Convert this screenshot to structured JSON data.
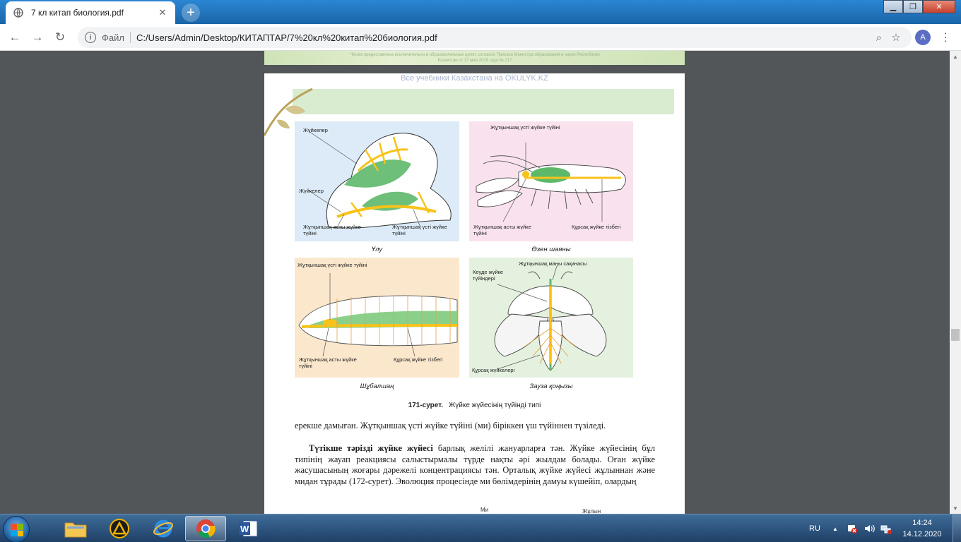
{
  "browser": {
    "tab_title": "7 кл китап биология.pdf",
    "new_tab_label": "+",
    "address_scheme": "Файл",
    "address_url": "C:/Users/Admin/Desktop/КИТАПТАР/7%20кл%20китап%20биология.pdf",
    "avatar_letter": "A"
  },
  "pdf": {
    "prev_page_fine_print": "*Книга предоставлена исключительно в образовательных целях согласно Приказа Министра образования и науки Республики Казахстан от 17 мая 2019 года № 217",
    "watermark": "Все учебники Казахстана на OKULYK.KZ",
    "figure": {
      "snail": {
        "labels": [
          "Жүйкелер",
          "Жүйкелер",
          "Жұтқыншақ асты жүйке түйіні",
          "Жұтқыншақ үсті жүйке түйіні"
        ],
        "caption": "Ұлу"
      },
      "crayfish": {
        "labels": [
          "Жұтқыншақ үсті жүйке түйіні",
          "Жұтқыншақ асты жүйке түйіні",
          "Құрсақ жүйке тізбегі"
        ],
        "caption": "Өзен шаяны"
      },
      "worm": {
        "labels": [
          "Жұтқыншақ үсті жүйке түйіні",
          "Жұтқыншақ асты жүйке түйіні",
          "Құрсақ жүйке тізбегі"
        ],
        "caption": "Шұбалшаң"
      },
      "beetle": {
        "labels": [
          "Жұтқыншақ маңы сақинасы",
          "Кеуде жүйке түйіндері",
          "Құрсақ жүйкелері"
        ],
        "caption": "Зауза қоңызы"
      },
      "number": "171-сурет.",
      "title": "Жүйке жүйесінің түйінді типі"
    },
    "paragraph1": "ерекше дамыған. Жұтқыншақ үсті жүйке түйіні (ми) біріккен үш түйіннен түзіледі.",
    "paragraph2_term": "Түтікше тәрізді жүйке жүйесі",
    "paragraph2_rest": " барлық желілі жануарларға тән. Жүйке жүйесінің бұл типінің жауап реакциясы салыстырмалы түрде нақты әрі жылдам болады. Оған жүйке жасушасының жоғары дәрежелі концентрациясы тән. Орталық жүйке жүйесі жұлыннан және мидан тұрады (172-сурет). Эволюция процесінде ми бөлімдерінің дамуы күшейіп, олардың",
    "next_fig_labels": [
      "Ми",
      "Жұлын"
    ]
  },
  "taskbar": {
    "lang": "RU",
    "time": "14:24",
    "date": "14.12.2020"
  },
  "colors": {
    "tabstrip": "#1d6fb8",
    "viewer_bg": "#525659",
    "panel_blue": "#dcebf7",
    "panel_pink": "#f9e2ee",
    "panel_peach": "#fbe7cc",
    "panel_green": "#e4f1de",
    "nerve_yellow": "#f7c21a",
    "organ_green": "#5db86a"
  }
}
